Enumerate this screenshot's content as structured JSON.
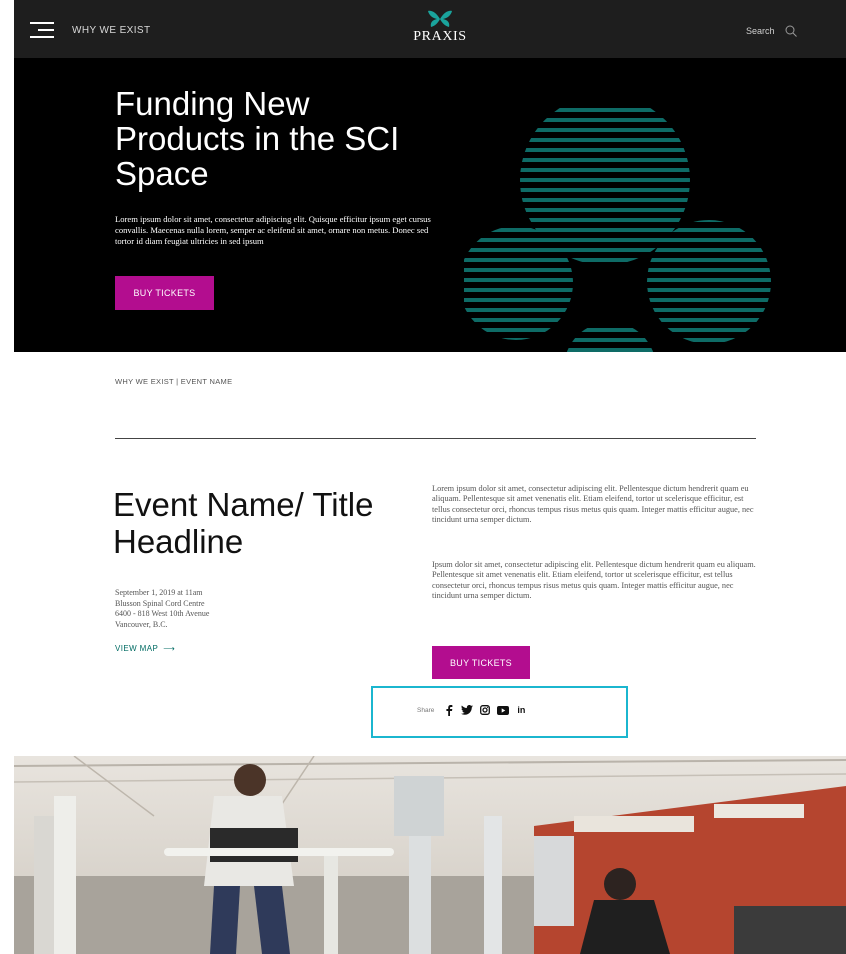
{
  "nav": {
    "link": "WHY WE EXIST",
    "logo_text": "PRAXIS",
    "search_label": "Search"
  },
  "hero": {
    "title": "Funding New Products in the SCI Space",
    "body": "Lorem ipsum dolor sit amet, consectetur adipiscing elit. Quisque efficitur ipsum eget cursus convallis. Maecenas nulla lorem, semper ac eleifend sit amet, ornare non metus. Donec sed tortor id diam feugiat ultricies in sed ipsum",
    "button": "BUY TICKETS"
  },
  "breadcrumb": "WHY WE EXIST | EVENT NAME",
  "event": {
    "title": "Event Name/ Title Headline",
    "details": [
      "September 1, 2019 at 11am",
      "Blusson Spinal Cord Centre",
      "6400 - 818 West 10th Avenue",
      "Vancouver, B.C."
    ],
    "view_map": "VIEW MAP",
    "paragraphs": [
      "Lorem ipsum dolor sit amet, consectetur adipiscing elit. Pellentesque dictum hendrerit quam eu aliquam. Pellentesque sit amet venenatis elit. Etiam eleifend, tortor ut scelerisque efficitur, est tellus consectetur orci, rhoncus tempus risus metus quis quam. Integer mattis efficitur augue, nec tincidunt urna semper dictum.",
      "Ipsum dolor sit amet, consectetur adipiscing elit. Pellentesque dictum hendrerit quam eu aliquam. Pellentesque sit amet venenatis elit. Etiam eleifend, tortor ut scelerisque efficitur, est tellus consectetur orci, rhoncus tempus risus metus quis quam. Integer mattis efficitur augue, nec tincidunt urna semper dictum."
    ],
    "button": "BUY TICKETS"
  },
  "share": {
    "label": "Share",
    "linkedin_label": "in",
    "icons": [
      "facebook-icon",
      "twitter-icon",
      "instagram-icon",
      "youtube-icon",
      "linkedin-icon"
    ]
  },
  "colors": {
    "nav_bg": "#1e1e1e",
    "hero_bg": "#000000",
    "accent": "#b30d8f",
    "teal": "#0e6b66",
    "highlight": "#1bb6cf"
  }
}
